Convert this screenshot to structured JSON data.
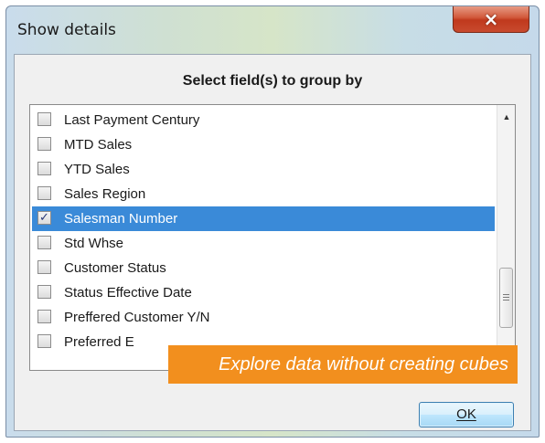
{
  "window": {
    "title": "Show details",
    "close_icon": "×"
  },
  "dialog": {
    "heading": "Select field(s) to group by",
    "ok_label": "OK",
    "items": [
      {
        "label": "Last Payment Century",
        "checked": false,
        "selected": false
      },
      {
        "label": "MTD Sales",
        "checked": false,
        "selected": false
      },
      {
        "label": "YTD Sales",
        "checked": false,
        "selected": false
      },
      {
        "label": "Sales Region",
        "checked": false,
        "selected": false
      },
      {
        "label": "Salesman Number",
        "checked": true,
        "selected": true
      },
      {
        "label": "Std Whse",
        "checked": false,
        "selected": false
      },
      {
        "label": "Customer Status",
        "checked": false,
        "selected": false
      },
      {
        "label": "Status Effective Date",
        "checked": false,
        "selected": false
      },
      {
        "label": "Preffered Customer Y/N",
        "checked": false,
        "selected": false
      },
      {
        "label": "Preferred E",
        "checked": false,
        "selected": false
      }
    ],
    "scroll_up_icon": "▲"
  },
  "banner": {
    "text": "Explore data without creating cubes"
  },
  "colors": {
    "selection": "#3a8ad8",
    "banner": "#f28f1e",
    "close_button": "#c84a2e"
  }
}
